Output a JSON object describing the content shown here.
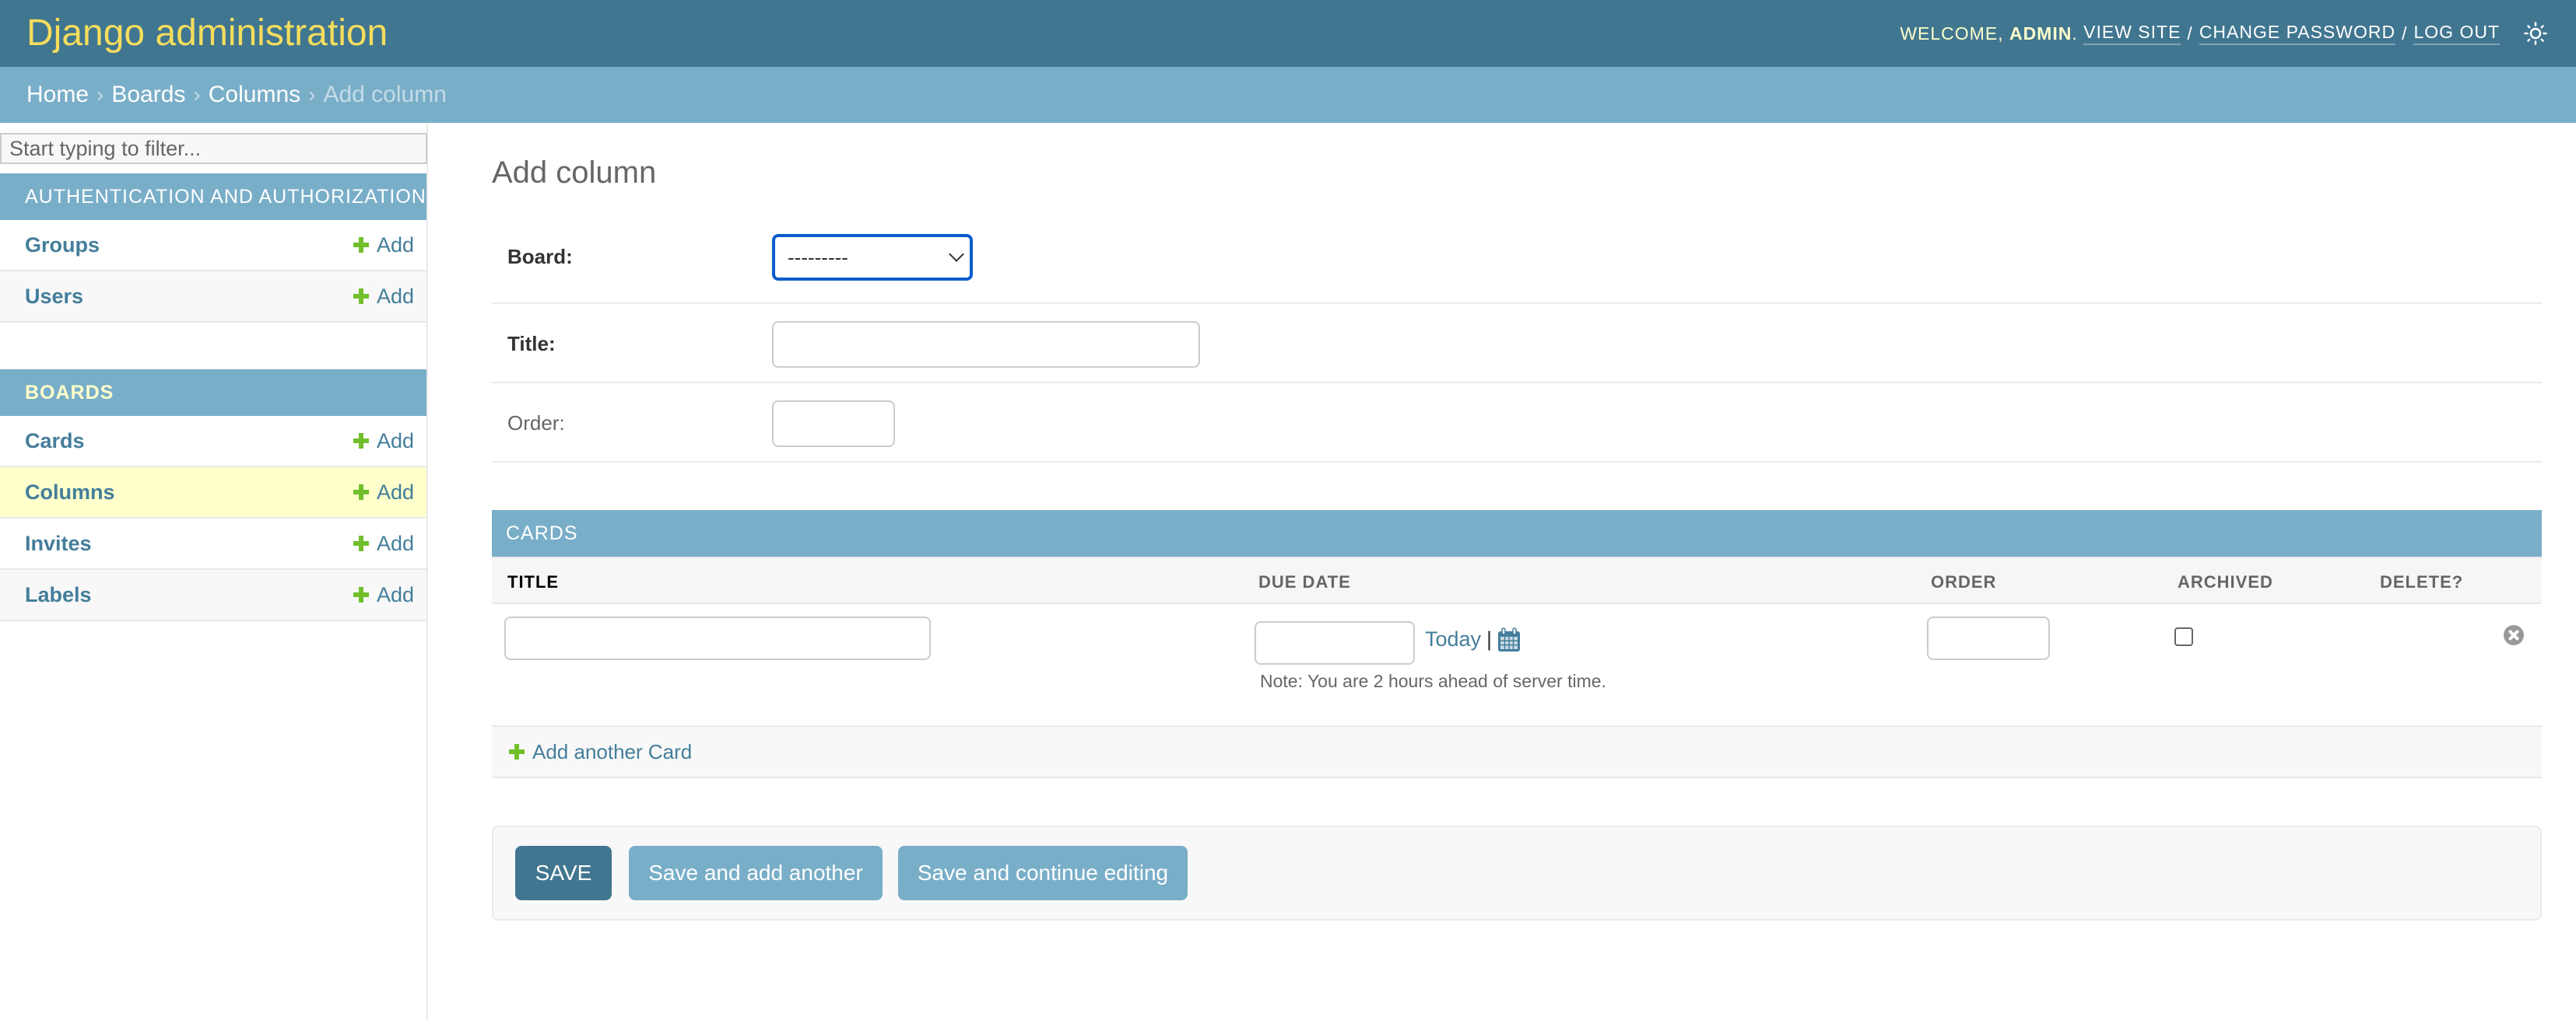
{
  "header": {
    "branding": "Django administration",
    "welcome": "Welcome,",
    "username": "admin",
    "view_site": "View site",
    "change_password": "Change password",
    "log_out": "Log out",
    "separator": "/",
    "theme_icon": "sun-icon"
  },
  "breadcrumbs": {
    "items": [
      "Home",
      "Boards",
      "Columns"
    ],
    "current": "Add column",
    "separator": "›"
  },
  "sidebar": {
    "filter_placeholder": "Start typing to filter...",
    "modules": [
      {
        "caption": "Authentication and Authorization",
        "models": [
          {
            "name": "Groups",
            "add": "Add"
          },
          {
            "name": "Users",
            "add": "Add"
          }
        ]
      },
      {
        "caption": "Boards",
        "models": [
          {
            "name": "Cards",
            "add": "Add"
          },
          {
            "name": "Columns",
            "add": "Add",
            "current": true
          },
          {
            "name": "Invites",
            "add": "Add"
          },
          {
            "name": "Labels",
            "add": "Add"
          }
        ]
      }
    ]
  },
  "form": {
    "title": "Add column",
    "fields": {
      "board": {
        "label": "Board:",
        "selected": "---------",
        "required": true
      },
      "title": {
        "label": "Title:",
        "value": "",
        "required": true
      },
      "order": {
        "label": "Order:",
        "value": "",
        "required": false
      }
    }
  },
  "inline": {
    "caption": "Cards",
    "columns": [
      "Title",
      "Due date",
      "Order",
      "Archived",
      "Delete?"
    ],
    "row": {
      "title": "",
      "due_date": "",
      "today_label": "Today",
      "pipe": "|",
      "order": "",
      "archived": false,
      "tz_note": "Note: You are 2 hours ahead of server time."
    },
    "add_another": "Add another Card"
  },
  "submit": {
    "save": "Save",
    "save_add_another": "Save and add another",
    "save_continue": "Save and continue editing"
  },
  "colors": {
    "header_bg": "#417690",
    "branding": "#f5dd5d",
    "breadcrumbs_bg": "#79aec8",
    "link": "#447e9b",
    "add_green": "#70bf2b",
    "current_row": "#ffffcc",
    "focus_blue": "#0a5ccc"
  }
}
